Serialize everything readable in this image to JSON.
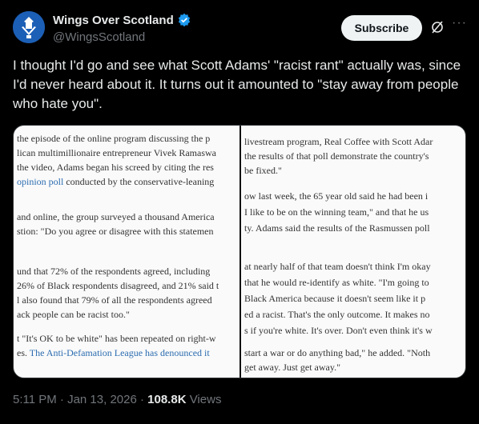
{
  "author": {
    "name": "Wings Over Scotland",
    "handle": "@WingsScotland"
  },
  "actions": {
    "subscribe_label": "Subscribe",
    "more_label": "···"
  },
  "tweet": {
    "text": "I thought I'd go and see what Scott Adams' \"racist rant\" actually was, since I'd never heard about it. It turns out it amounted to \"stay away from people who hate you\"."
  },
  "screenshot": {
    "left_lines": [
      "the episode of the online program discussing the p",
      "lican multimillionaire entrepreneur Vivek Ramaswa",
      "the video, Adams began his screed by citing the res",
      "opinion poll",
      " conducted by the conservative-leaning",
      " and online, the group surveyed a thousand America",
      "stion: \"Do you agree or disagree with this statemen",
      "und that 72% of the respondents agreed, including",
      "26% of Black respondents disagreed, and 21% said t",
      "l also found that 79% of all the respondents agreed",
      "ack people can be racist too.\"",
      "t \"It's OK to be white\" has been repeated on right-w",
      "es. ",
      "The Anti-Defamation League has denounced it"
    ],
    "right_lines": [
      "livestream program, Real Coffee with Scott Adar",
      "the results of that poll demonstrate the country's",
      "be fixed.\"",
      "ow last week, the 65 year old said he had been i",
      "I like to be on the winning team,\" and that he us",
      "ty. Adams said the results of the Rasmussen poll",
      "at nearly half of that team doesn't think I'm okay",
      "that he would re-identify as white. \"I'm going to",
      "Black America because it doesn't seem like it p",
      "ed a racist. That's the only outcome. It makes no",
      "s if you're white. It's over. Don't even think it's w",
      "start a war or do anything bad,\" he added. \"Noth",
      "get away. Just get away.\""
    ]
  },
  "meta": {
    "time": "5:11 PM · Jan 13, 2026 · ",
    "views_count": "108.8K",
    "views_label": " Views"
  },
  "colors": {
    "background": "#000000",
    "text": "#e7e9ea",
    "muted": "#71767b",
    "verified": "#1d9bf0",
    "link": "#2b6cb0"
  },
  "icons": [
    "avatar-logo",
    "verified-badge-icon",
    "grok-icon",
    "more-icon"
  ]
}
